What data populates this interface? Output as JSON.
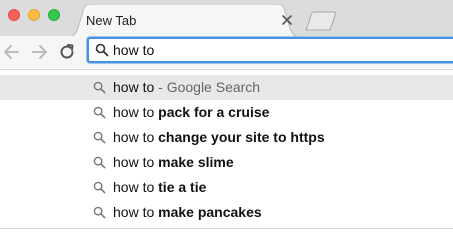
{
  "window": {
    "colors": {
      "close": "#fc605c",
      "minimize": "#fdbc40",
      "maximize": "#34c84a",
      "focus_ring": "#4a90e2"
    }
  },
  "tab": {
    "title": "New Tab",
    "close_icon": "close-icon"
  },
  "toolbar": {
    "back_icon": "arrow-left-icon",
    "forward_icon": "arrow-right-icon",
    "reload_icon": "reload-icon"
  },
  "omnibox": {
    "value": "how to",
    "icon": "search-icon"
  },
  "suggestions": [
    {
      "prefix": "how to",
      "completion": "",
      "engine": " - Google Search",
      "selected": true
    },
    {
      "prefix": "how to ",
      "completion": "pack for a cruise",
      "engine": "",
      "selected": false
    },
    {
      "prefix": "how to ",
      "completion": "change your site to https",
      "engine": "",
      "selected": false
    },
    {
      "prefix": "how to ",
      "completion": "make slime",
      "engine": "",
      "selected": false
    },
    {
      "prefix": "how to ",
      "completion": "tie a tie",
      "engine": "",
      "selected": false
    },
    {
      "prefix": "how to ",
      "completion": "make pancakes",
      "engine": "",
      "selected": false
    }
  ]
}
